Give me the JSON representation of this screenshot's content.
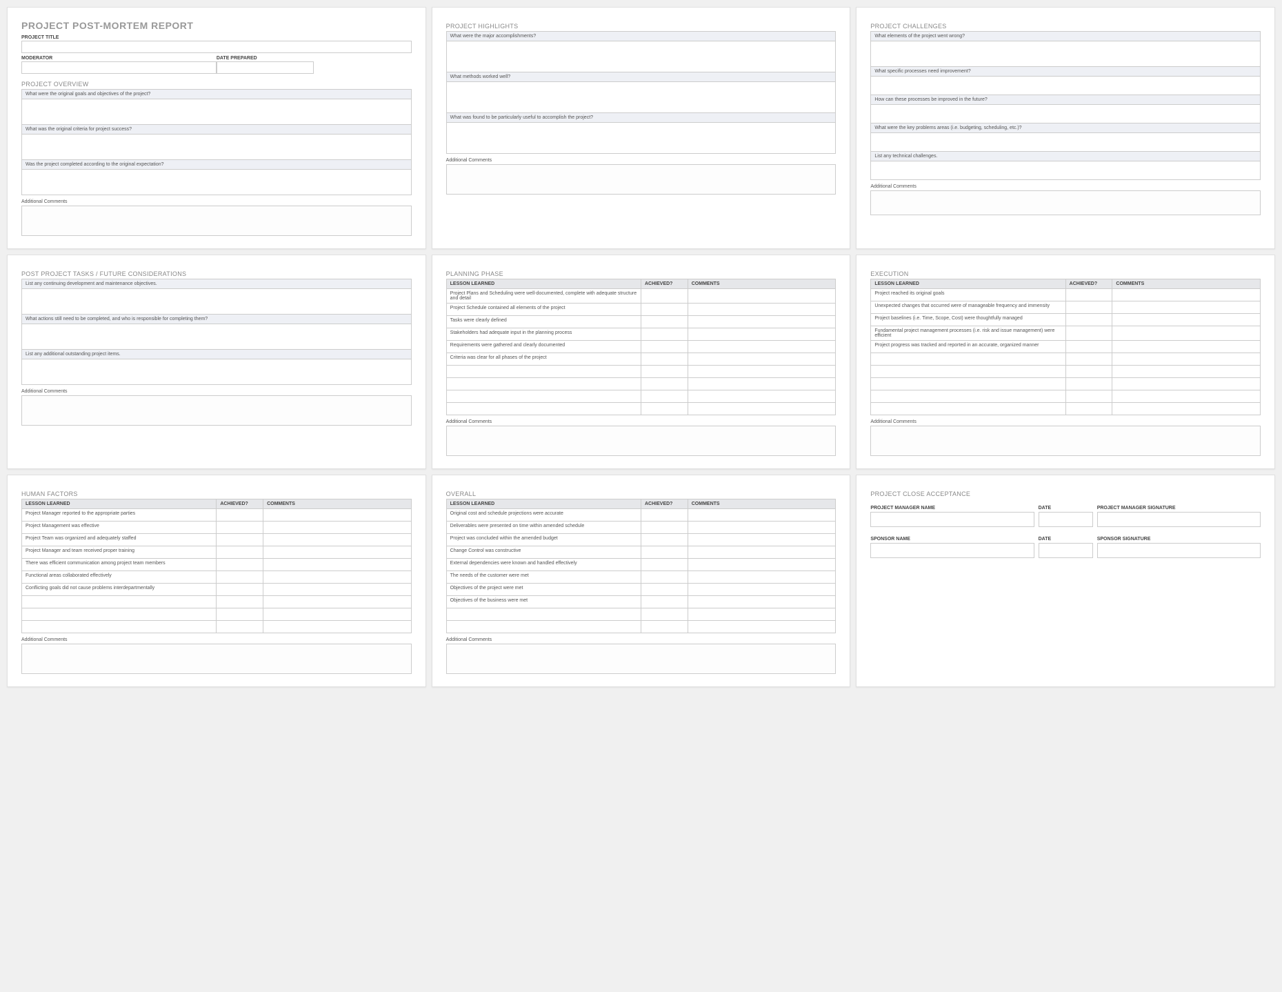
{
  "panel1": {
    "title": "PROJECT POST-MORTEM REPORT",
    "project_title_label": "PROJECT TITLE",
    "moderator_label": "MODERATOR",
    "date_prepared_label": "DATE PREPARED",
    "overview_title": "PROJECT OVERVIEW",
    "q1": "What were the original goals and objectives of the project?",
    "q2": "What was the original criteria for project success?",
    "q3": "Was the project completed according to the original expectation?",
    "comments_label": "Additional Comments"
  },
  "panel2": {
    "title": "PROJECT HIGHLIGHTS",
    "q1": "What were the major accomplishments?",
    "q2": "What methods worked well?",
    "q3": "What was found to be particularly useful to accomplish the project?",
    "comments_label": "Additional Comments"
  },
  "panel3": {
    "title": "PROJECT CHALLENGES",
    "q1": "What elements of the project went wrong?",
    "q2": "What specific processes need improvement?",
    "q3": "How can these processes be improved in the future?",
    "q4": "What were the key problems areas (i.e. budgeting, scheduling, etc.)?",
    "q5": "List any technical challenges.",
    "comments_label": "Additional Comments"
  },
  "panel4": {
    "title": "POST PROJECT TASKS / FUTURE CONSIDERATIONS",
    "q1": "List any continuing development and maintenance objectives.",
    "q2": "What actions still need to be completed, and who is responsible for completing them?",
    "q3": "List any additional outstanding project items.",
    "comments_label": "Additional Comments"
  },
  "panel5": {
    "title": "PLANNING PHASE",
    "th_lesson": "LESSON LEARNED",
    "th_achieved": "ACHIEVED?",
    "th_comments": "COMMENTS",
    "rows": [
      "Project Plans and Scheduling were well-documented, complete with adequate structure and detail",
      "Project Schedule contained all elements of the project",
      "Tasks were clearly defined",
      "Stakeholders had adequate input in the planning process",
      "Requirements were gathered and clearly documented",
      "Criteria was clear for all phases of the project",
      "",
      "",
      "",
      ""
    ],
    "comments_label": "Additional Comments"
  },
  "panel6": {
    "title": "EXECUTION",
    "th_lesson": "LESSON LEARNED",
    "th_achieved": "ACHIEVED?",
    "th_comments": "COMMENTS",
    "rows": [
      "Project reached its original goals",
      "Unexpected changes that occurred were of manageable frequency and immensity",
      "Project baselines (i.e. Time, Scope, Cost) were thoughtfully managed",
      "Fundamental project management processes (i.e. risk and issue management) were efficient",
      "Project progress was tracked and reported in an accurate, organized manner",
      "",
      "",
      "",
      "",
      ""
    ],
    "comments_label": "Additional Comments"
  },
  "panel7": {
    "title": "HUMAN FACTORS",
    "th_lesson": "LESSON LEARNED",
    "th_achieved": "ACHIEVED?",
    "th_comments": "COMMENTS",
    "rows": [
      "Project Manager reported to the appropriate parties",
      "Project Management was effective",
      "Project Team was organized and adequately staffed",
      "Project Manager and team received proper training",
      "There was efficient communication among project team members",
      "Functional areas collaborated effectively",
      "Conflicting goals did not cause problems interdepartmentally",
      "",
      "",
      ""
    ],
    "comments_label": "Additional Comments"
  },
  "panel8": {
    "title": "OVERALL",
    "th_lesson": "LESSON LEARNED",
    "th_achieved": "ACHIEVED?",
    "th_comments": "COMMENTS",
    "rows": [
      "Original cost and schedule projections were accurate",
      "Deliverables were presented on time within amended schedule",
      "Project was concluded within the amended budget",
      "Change Control was constructive",
      "External dependencies were known and handled effectively",
      "The needs of the customer were met",
      "Objectives of the project were met",
      "Objectives of the business were met",
      "",
      ""
    ],
    "comments_label": "Additional Comments"
  },
  "panel9": {
    "title": "PROJECT CLOSE ACCEPTANCE",
    "pm_name": "PROJECT MANAGER NAME",
    "date": "DATE",
    "pm_sig": "PROJECT MANAGER SIGNATURE",
    "sponsor_name": "SPONSOR NAME",
    "sponsor_sig": "SPONSOR SIGNATURE"
  }
}
